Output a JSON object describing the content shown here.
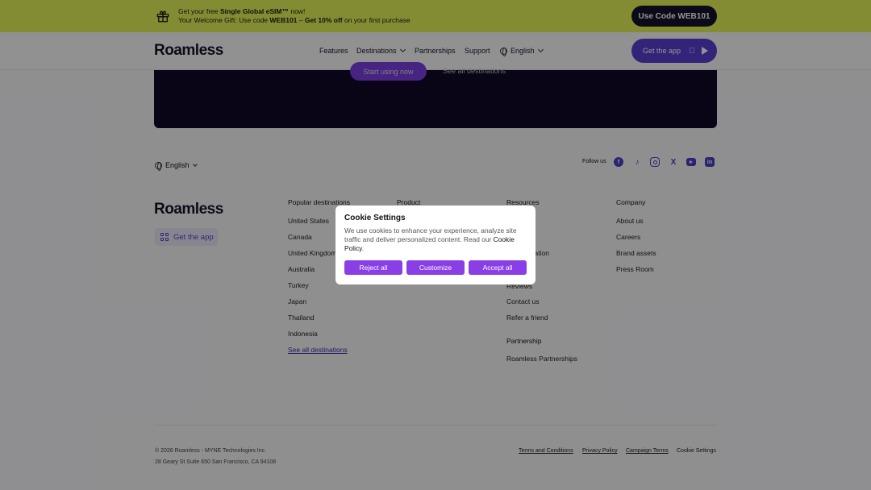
{
  "promo": {
    "line1_prefix": "Get your free ",
    "line1_bold": "Single Global eSIM™",
    "line1_suffix": " now!",
    "line2_prefix": "Your Welcome Gift: Use code ",
    "line2_code": "WEB101",
    "line2_mid": " – ",
    "line2_bold": "Get 10% off",
    "line2_suffix": " on your first purchase",
    "button_label": "Use Code WEB101"
  },
  "header": {
    "logo": "Roamless",
    "nav": [
      "Features",
      "Destinations",
      "Partnerships",
      "Support",
      "English"
    ],
    "get_app_label": "Get the app"
  },
  "hero": {
    "start_label": "Start using now",
    "see_all_label": "See all destinations"
  },
  "footer": {
    "language": "English",
    "follow_label": "Follow us",
    "social": [
      "facebook-icon",
      "tiktok-icon",
      "instagram-icon",
      "x-icon",
      "youtube-icon",
      "linkedin-icon"
    ],
    "logo": "Roamless",
    "get_app_label": "Get the app",
    "columns": {
      "popular": {
        "heading": "Popular destinations",
        "items": [
          "United States",
          "Canada",
          "United Kingdom",
          "Australia",
          "Turkey",
          "Japan",
          "Thailand",
          "Indonesia"
        ],
        "see_all": "See all destinations"
      },
      "product": {
        "heading": "Product"
      },
      "resources": {
        "heading": "Resources",
        "visible_items": [
          "allation",
          "Reviews",
          "Contact us",
          "Refer a friend"
        ],
        "partnership_heading": "Partnership",
        "partnership_item": "Roamless Partnerships"
      },
      "company": {
        "heading": "Company",
        "items": [
          "About us",
          "Careers",
          "Brand assets",
          "Press Room"
        ]
      }
    },
    "copyright": "© 2026 Roamless - MYNE Technologies Inc.",
    "address": "28 Geary St Suite 650 San Francisco, CA 94108",
    "legal": [
      "Terms and Conditions",
      "Privacy Policy",
      "Campaign Terms",
      "Cookie Settings"
    ]
  },
  "cookie": {
    "title": "Cookie Settings",
    "body": "We use cookies to enhance your experience, analyze site traffic and deliver personalized content. Read our ",
    "policy_link": "Cookie Policy",
    "body_end": ".",
    "reject": "Reject all",
    "customize": "Customize",
    "accept": "Accept all"
  },
  "colors": {
    "promo_bg": "#e3f258",
    "brand_purple": "#5a3fd1",
    "cookie_button": "#8a3fe6",
    "dark_hero": "#100a26"
  }
}
